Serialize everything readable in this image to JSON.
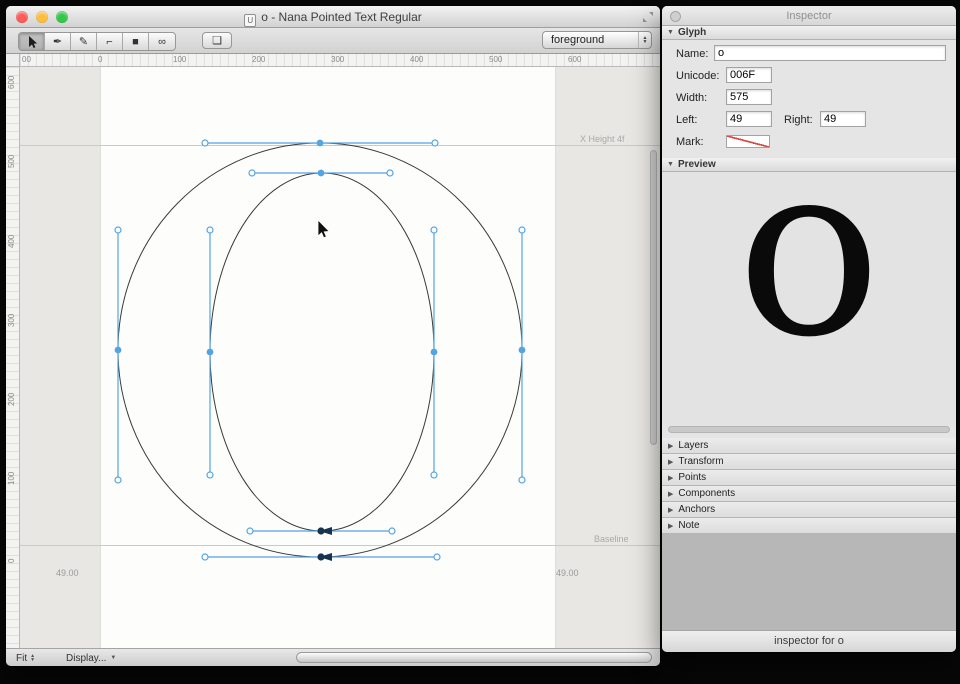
{
  "colors": {
    "handle_blue": "#54a4e2",
    "outline": "#3a3a3a",
    "guide": "#c9c9c9",
    "selected_point": "#16344f",
    "mark_stripe_red": "#d94a43"
  },
  "icons": {
    "disclosure_open": "▼",
    "disclosure_closed": "▶",
    "popup_up": "▲",
    "popup_down": "▼",
    "display_triangle": "▼",
    "pen_tool": "✒",
    "pencil_tool": "✎",
    "corner_tool": "⌐",
    "rect_tool": "■",
    "shapes_tool": "∞",
    "transform_tool": "❏",
    "proxy_badge": "U"
  },
  "main_window": {
    "title": "o - Nana Pointed Text Regular",
    "layer_popup_value": "foreground",
    "ruler_h": [
      "00",
      "0",
      "100",
      "200",
      "300",
      "400",
      "500",
      "600"
    ],
    "ruler_v": [
      "600",
      "500",
      "400",
      "300",
      "200",
      "100",
      "0"
    ],
    "canvas": {
      "xheight_label": "X Height 4f",
      "baseline_label": "Baseline",
      "left_sidebearing": "49.00",
      "right_sidebearing": "49.00"
    },
    "statusbar": {
      "fit": "Fit",
      "display": "Display..."
    }
  },
  "inspector": {
    "title": "Inspector",
    "glyph": {
      "header": "Glyph",
      "name_label": "Name:",
      "name": "o",
      "unicode_label": "Unicode:",
      "unicode": "006F",
      "width_label": "Width:",
      "width": "575",
      "left_label": "Left:",
      "left": "49",
      "right_label": "Right:",
      "right": "49",
      "mark_label": "Mark:"
    },
    "preview": {
      "header": "Preview",
      "glyph": "o"
    },
    "sections": [
      {
        "label": "Layers"
      },
      {
        "label": "Transform"
      },
      {
        "label": "Points"
      },
      {
        "label": "Components"
      },
      {
        "label": "Anchors"
      },
      {
        "label": "Note"
      }
    ],
    "footer": "inspector for o"
  }
}
